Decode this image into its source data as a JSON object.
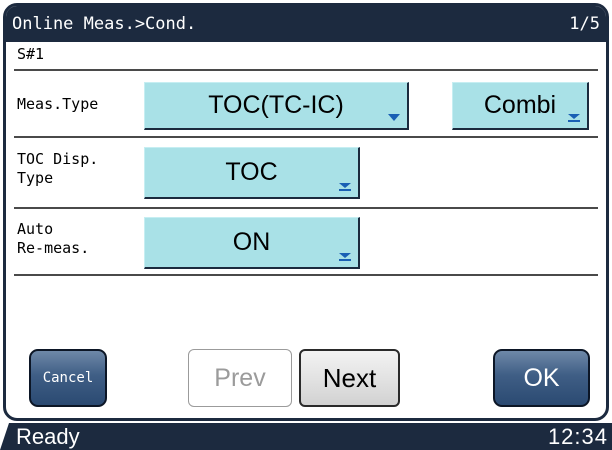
{
  "header": {
    "title": "Online Meas.>Cond.",
    "page": "1/5"
  },
  "stream_label": "S#1",
  "rows": {
    "meas_type": {
      "label": "Meas.Type",
      "value": "TOC(TC-IC)",
      "mode_value": "Combi"
    },
    "toc_disp_type": {
      "label_line1": "TOC Disp.",
      "label_line2": "Type",
      "value": "TOC"
    },
    "auto_remeas": {
      "label_line1": "Auto",
      "label_line2": "Re-meas.",
      "value": "ON"
    }
  },
  "buttons": {
    "cancel": "Cancel",
    "prev": "Prev",
    "next": "Next",
    "ok": "OK"
  },
  "status_bar": {
    "status": "Ready",
    "clock": "12:34"
  },
  "colors": {
    "bar": "#1c2a3f",
    "dropdown": "#a9e1e7",
    "dropdown_arrow": "#1a5fb4"
  }
}
